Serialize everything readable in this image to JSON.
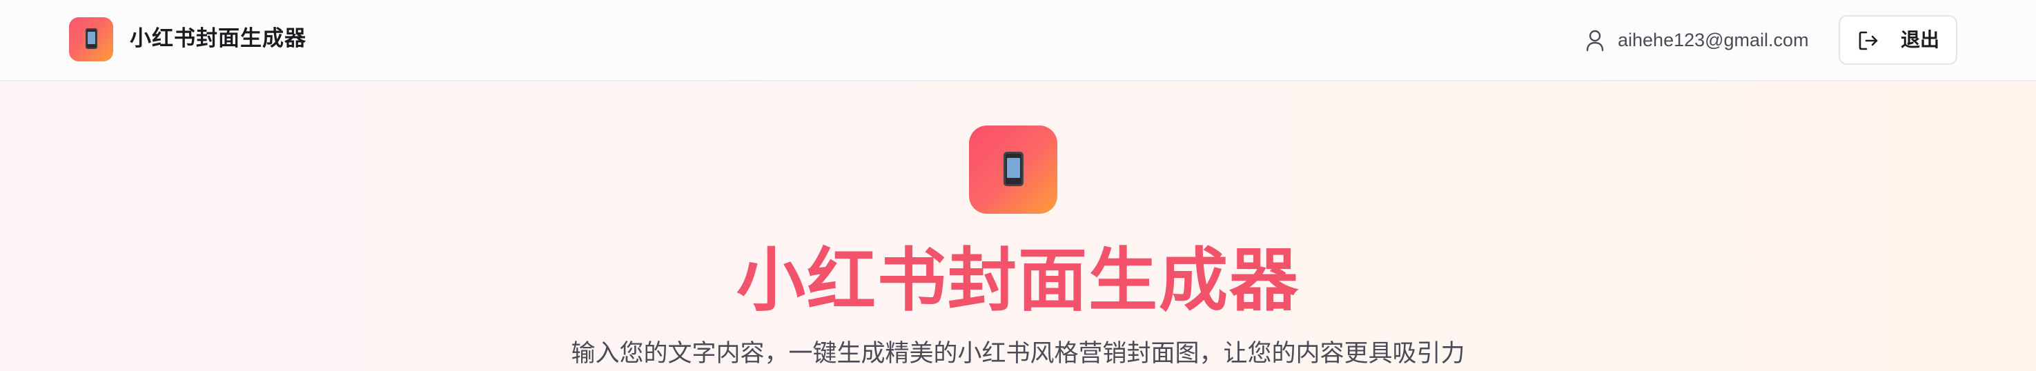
{
  "header": {
    "app_title": "小红书封面生成器",
    "logo_icon": "phone-icon",
    "user_icon": "user-icon",
    "user_email": "aihehe123@gmail.com",
    "logout_icon": "logout-icon",
    "logout_label": "退出"
  },
  "hero": {
    "icon": "phone-icon",
    "title": "小红书封面生成器",
    "subtitle": "输入您的文字内容，一键生成精美的小红书风格营销封面图，让您的内容更具吸引力"
  },
  "colors": {
    "brand_gradient_start": "#fb4f6d",
    "brand_gradient_end": "#fd9d3a",
    "title_color": "#f2536a"
  }
}
